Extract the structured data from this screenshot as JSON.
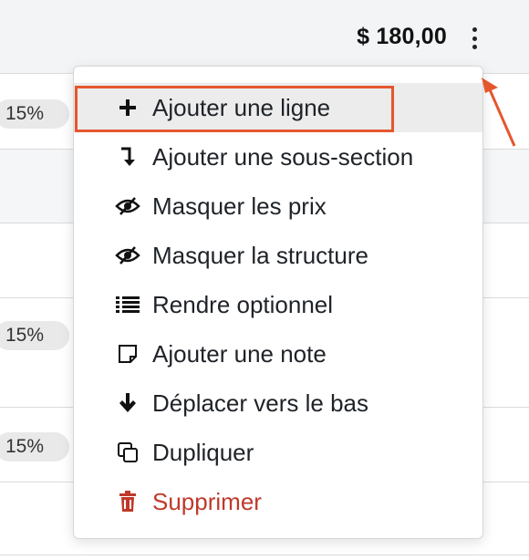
{
  "header": {
    "total": "$ 180,00"
  },
  "rows": {
    "tax_values": [
      "15%",
      "15%",
      "15%"
    ]
  },
  "menu": {
    "items": [
      {
        "label": "Ajouter une ligne",
        "icon": "plus-icon"
      },
      {
        "label": "Ajouter une sous-section",
        "icon": "arrow-down-right-icon"
      },
      {
        "label": "Masquer les prix",
        "icon": "eye-slash-icon"
      },
      {
        "label": "Masquer la structure",
        "icon": "eye-slash-icon"
      },
      {
        "label": "Rendre optionnel",
        "icon": "list-icon"
      },
      {
        "label": "Ajouter une note",
        "icon": "note-icon"
      },
      {
        "label": "Déplacer vers le bas",
        "icon": "arrow-down-icon"
      },
      {
        "label": "Dupliquer",
        "icon": "copy-icon"
      },
      {
        "label": "Supprimer",
        "icon": "trash-icon"
      }
    ]
  },
  "colors": {
    "accent": "#e4572e",
    "danger": "#c0392b"
  }
}
